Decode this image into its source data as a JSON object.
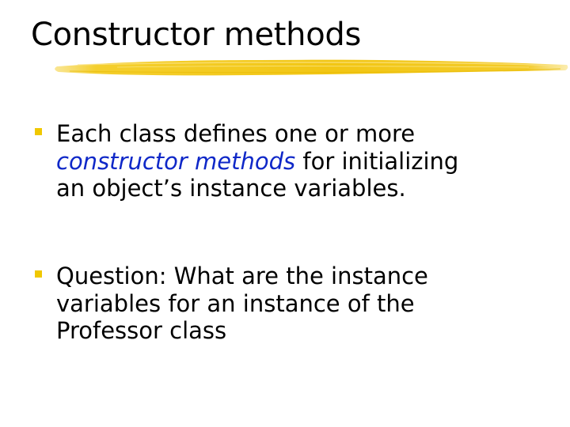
{
  "slide": {
    "title": "Constructor methods",
    "accent_color": "#f0c800",
    "emphasis_color": "#0f28c8",
    "bullets": [
      {
        "line1": "Each class defines one or more",
        "line2_emphasis": "constructor methods",
        "line2_rest": " for initializing",
        "line3": "an object’s instance variables."
      },
      {
        "line1": "Question: What are the instance",
        "line2": "variables for an instance of the",
        "line3": "Professor class"
      }
    ]
  }
}
